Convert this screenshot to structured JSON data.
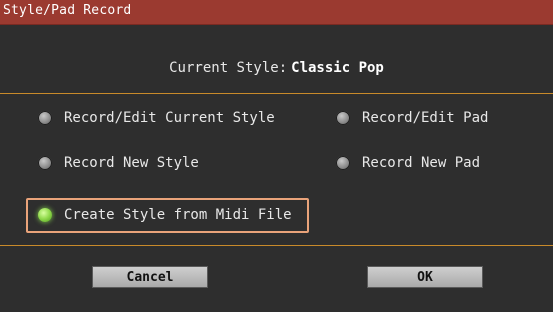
{
  "window": {
    "title": "Style/Pad Record"
  },
  "current_style": {
    "label": "Current Style:",
    "value": "Classic Pop"
  },
  "options": [
    {
      "label": "Record/Edit Current Style",
      "selected": false
    },
    {
      "label": "Record/Edit Pad",
      "selected": false
    },
    {
      "label": "Record New Style",
      "selected": false
    },
    {
      "label": "Record New Pad",
      "selected": false
    },
    {
      "label": "Create Style from Midi File",
      "selected": true
    }
  ],
  "buttons": {
    "cancel": "Cancel",
    "ok": "OK"
  },
  "colors": {
    "titlebar": "#9b3a30",
    "divider": "#c98a2a",
    "selection_outline": "#e9a37a",
    "radio_selected": "#8fd94a"
  }
}
